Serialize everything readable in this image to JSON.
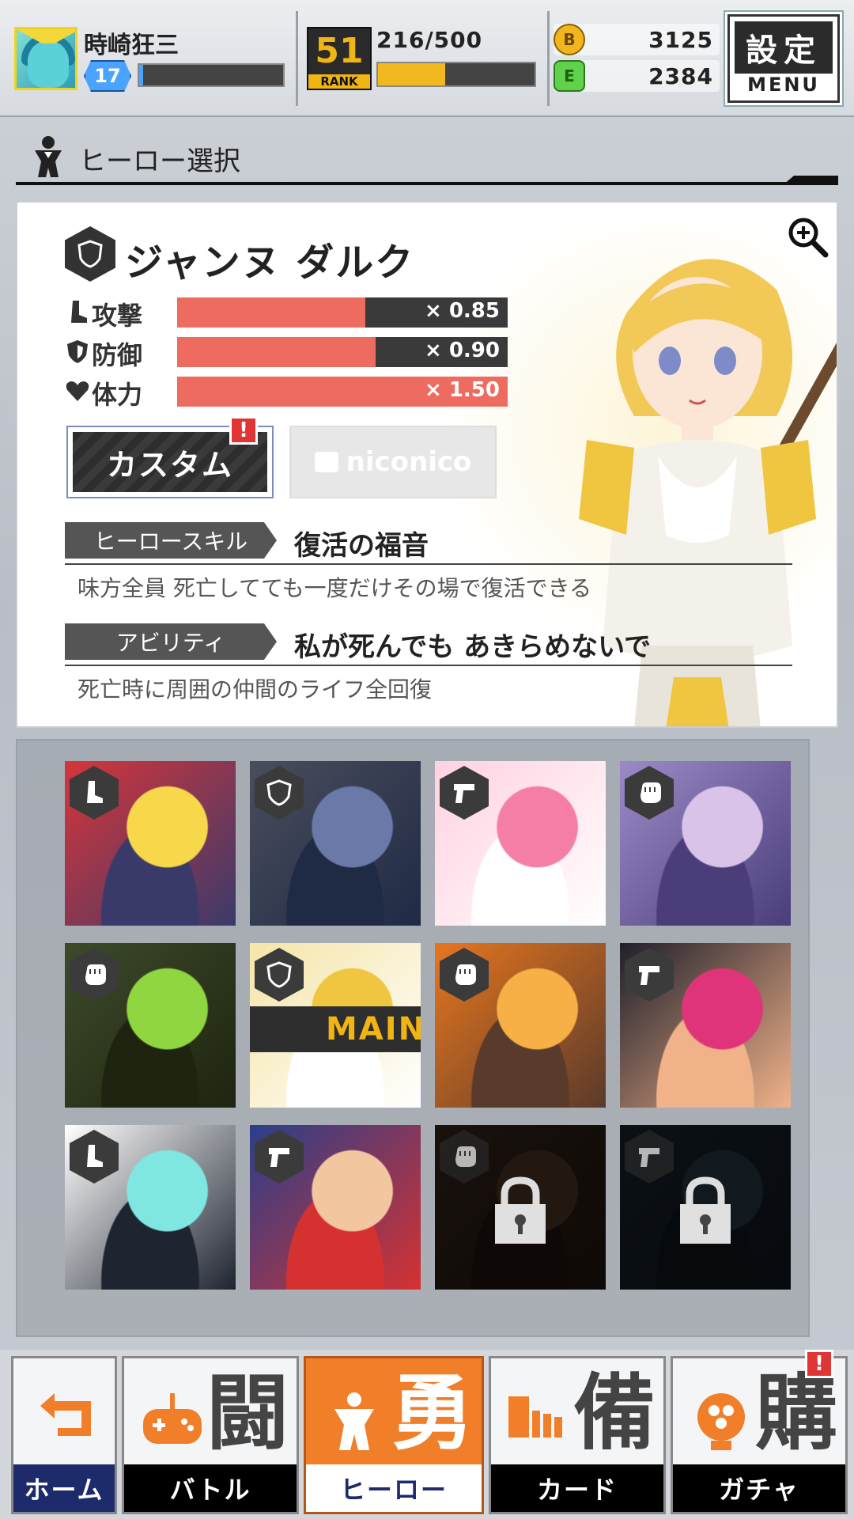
{
  "player": {
    "name": "時崎狂三",
    "level": "17",
    "exp_fraction": 0.03
  },
  "rank": {
    "value": "51",
    "label": "RANK",
    "exp_text": "216/500",
    "exp_fraction": 0.43
  },
  "currency": {
    "coin_icon": "B",
    "coin_value": "3125",
    "gem_icon": "E",
    "gem_value": "2384"
  },
  "menu": {
    "main_label": "設定",
    "sub_label": "MENU"
  },
  "section": {
    "title": "ヒーロー選択"
  },
  "hero": {
    "name": "ジャンヌ ダルク",
    "class_icon": "shield-icon",
    "stats": [
      {
        "label": "攻撃",
        "icon": "boot-icon",
        "multiplier": "× 0.85",
        "fraction": 0.57
      },
      {
        "label": "防御",
        "icon": "shield-icon",
        "multiplier": "× 0.90",
        "fraction": 0.6
      },
      {
        "label": "体力",
        "icon": "heart-icon",
        "multiplier": "× 1.50",
        "fraction": 1.0
      }
    ],
    "custom_button": "カスタム",
    "custom_alert": "!",
    "nico_button": "niconico",
    "skill_tag": "ヒーロースキル",
    "skill_name": "復活の福音",
    "skill_desc": "味方全員 死亡してても一度だけその場で復活できる",
    "ability_tag": "アビリティ",
    "ability_name": "私が死んでも あきらめないで",
    "ability_desc": "死亡時に周囲の仲間のライフ全回復"
  },
  "roster": {
    "main_tag": "MAIN",
    "heroes": [
      {
        "class": "boot-icon",
        "colors": [
          "#d6353a",
          "#f6d84a",
          "#3a3a6a"
        ],
        "locked": false
      },
      {
        "class": "shield-icon",
        "colors": [
          "#4a4d5c",
          "#6a79a8",
          "#1f2a45"
        ],
        "locked": false
      },
      {
        "class": "gun-icon",
        "colors": [
          "#ffd1e1",
          "#f57ea6",
          "#fff"
        ],
        "locked": false
      },
      {
        "class": "fist-icon",
        "colors": [
          "#9b8ac6",
          "#d9c3e8",
          "#4a3d7a"
        ],
        "locked": false
      },
      {
        "class": "fist-icon",
        "colors": [
          "#3d4a2a",
          "#8fd640",
          "#1e2410"
        ],
        "locked": false
      },
      {
        "class": "shield-icon",
        "colors": [
          "#f5e5a8",
          "#f0c640",
          "#fff"
        ],
        "locked": false
      },
      {
        "class": "fist-icon",
        "colors": [
          "#e6761f",
          "#f7b045",
          "#5a3a2a"
        ],
        "locked": false
      },
      {
        "class": "gun-icon",
        "colors": [
          "#1f1f2a",
          "#e0347a",
          "#f1b28a"
        ],
        "locked": false
      },
      {
        "class": "boot-icon",
        "colors": [
          "#ffffff",
          "#7fe7e0",
          "#1e2430"
        ],
        "locked": false
      },
      {
        "class": "gun-icon",
        "colors": [
          "#2a3f8a",
          "#f2c7a0",
          "#d63131"
        ],
        "locked": false
      },
      {
        "class": "fist-icon",
        "colors": [
          "#5a4030",
          "#7a5838",
          "#332218"
        ],
        "locked": true
      },
      {
        "class": "gun-icon",
        "colors": [
          "#2a3d4e",
          "#3f5a6e",
          "#1a2530"
        ],
        "locked": true
      }
    ]
  },
  "nav": {
    "home_label": "ホーム",
    "battle_label": "バトル",
    "battle_kanji": "闘",
    "hero_label": "ヒーロー",
    "hero_kanji": "勇",
    "card_label": "カード",
    "card_kanji": "備",
    "gacha_label": "ガチャ",
    "gacha_kanji": "購",
    "gacha_alert": "!"
  },
  "colors": {
    "accent_orange": "#f17f2a",
    "stat_red": "#ee6b5f",
    "rank_gold": "#f0b415",
    "exp_blue": "#4aa3ff",
    "alert_red": "#e03535"
  }
}
